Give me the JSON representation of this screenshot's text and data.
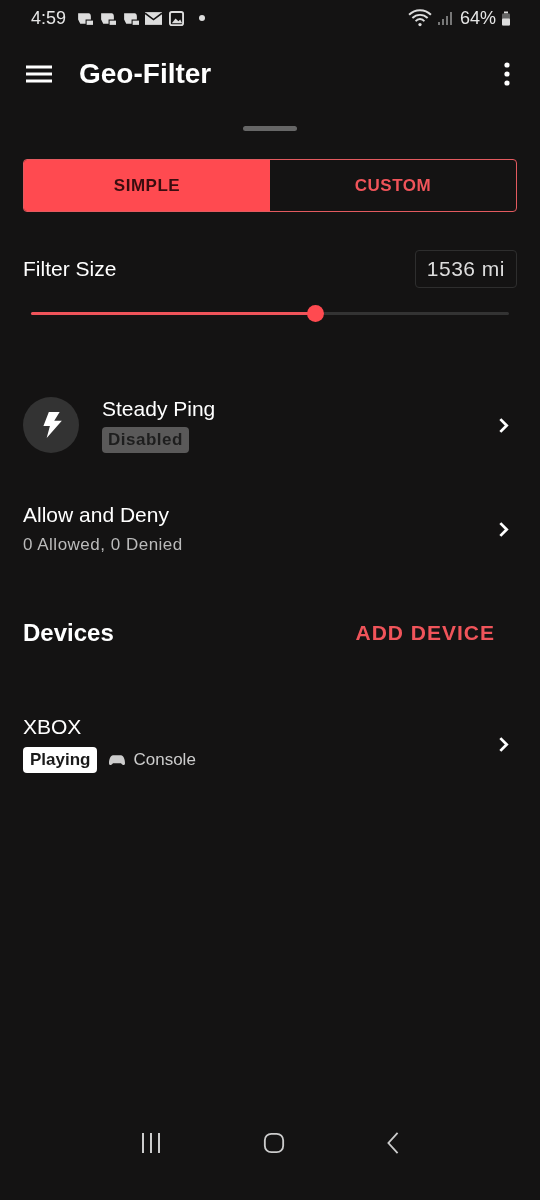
{
  "status_bar": {
    "time": "4:59",
    "battery": "64%"
  },
  "app_bar": {
    "title": "Geo-Filter"
  },
  "mode_tabs": [
    {
      "label": "SIMPLE",
      "selected": true
    },
    {
      "label": "CUSTOM",
      "selected": false
    }
  ],
  "filter_size": {
    "label": "Filter Size",
    "reading": "1536 mi",
    "level": 0.596
  },
  "settings": [
    {
      "kind": "icon",
      "title": "Steady Ping",
      "badge": "Disabled",
      "enabled": false
    },
    {
      "kind": "plain",
      "title": "Allow and Deny",
      "subtitle": "0 Allowed, 0 Denied"
    }
  ],
  "devices": {
    "title": "Devices",
    "action": "ADD DEVICE",
    "items": [
      {
        "name": "XBOX",
        "status": "Playing",
        "type": "Console"
      }
    ]
  }
}
